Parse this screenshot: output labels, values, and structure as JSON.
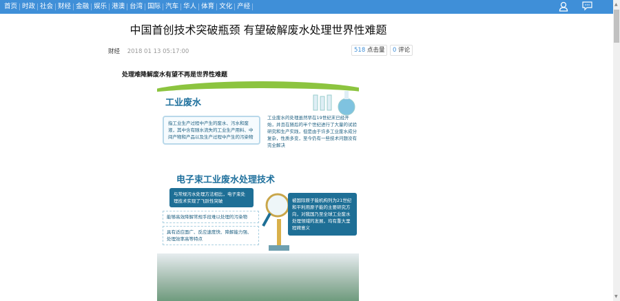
{
  "nav": {
    "items": [
      "首页",
      "时政",
      "社会",
      "财经",
      "金融",
      "娱乐",
      "港澳",
      "台湾",
      "国际",
      "汽车",
      "华人",
      "体育",
      "文化",
      "产经"
    ]
  },
  "article": {
    "title": "中国首创技术突破瓶颈 有望破解废水处理世界性难题",
    "category": "财经",
    "datetime": "2018 01 13 05:17:00",
    "clicks": "518",
    "clicks_label": "点击量",
    "comments": "0",
    "comments_label": "评论",
    "subtitle": "处理难降解废水有望不再是世界性难题"
  },
  "infographic": {
    "h1": "工业废水",
    "def": "指工业生产过程中产生的废水、污水和废液，其中含有随水流失的工业生产用料、中间产物和产品以及生产过程中产生的污染物",
    "hist": "工业废水的处理虽然早在19世纪末已经开始，并且在随后的半个世纪进行了大量的试验研究和生产实践，但是由于许多工业废水成分复杂，性质多变，至今仍有一些技术问题没有完全解决",
    "h2": "电子束工业废水处理技术",
    "p1": "与常规污水处理方法相比，电子束处理技术实现了飞跃性突破",
    "p2": "能够高效降解常规手段难以处理的污染物",
    "p3": "具有适应面广、反应速度快、降解能力强、处理效率高等特点",
    "p4": "被国际原子能机构列为21世纪和平利用原子能的主要研究方向，对我国乃至全球工业废水处理领域的发展，均有重大里程碑意义"
  }
}
